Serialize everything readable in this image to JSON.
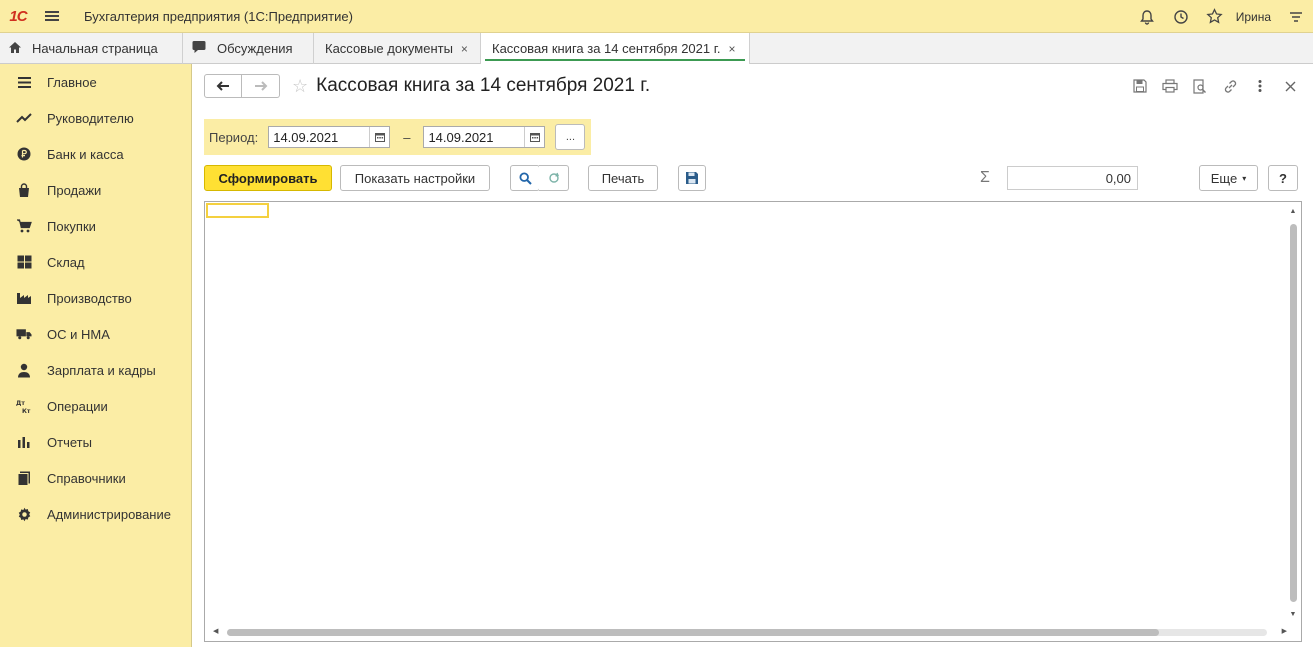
{
  "app": {
    "logo_text": "1С",
    "title": "Бухгалтерия предприятия (1С:Предприятие)",
    "user": "Ирина"
  },
  "tabs": [
    {
      "label": "Начальная страница",
      "icon": "home-icon"
    },
    {
      "label": "Обсуждения",
      "icon": "chat-icon"
    },
    {
      "label": "Кассовые документы",
      "close": "×"
    },
    {
      "label": "Кассовая книга за 14 сентября 2021 г.",
      "close": "×",
      "active": true
    }
  ],
  "sidebar": {
    "items": [
      {
        "label": "Главное",
        "icon": "menu-icon"
      },
      {
        "label": "Руководителю",
        "icon": "trend-icon"
      },
      {
        "label": "Банк и касса",
        "icon": "ruble-icon"
      },
      {
        "label": "Продажи",
        "icon": "bag-icon"
      },
      {
        "label": "Покупки",
        "icon": "cart-icon"
      },
      {
        "label": "Склад",
        "icon": "warehouse-icon"
      },
      {
        "label": "Производство",
        "icon": "factory-icon"
      },
      {
        "label": "ОС и НМА",
        "icon": "truck-icon"
      },
      {
        "label": "Зарплата и кадры",
        "icon": "person-icon"
      },
      {
        "label": "Операции",
        "icon": "dt-kt-icon"
      },
      {
        "label": "Отчеты",
        "icon": "bar-chart-icon"
      },
      {
        "label": "Справочники",
        "icon": "books-icon"
      },
      {
        "label": "Администрирование",
        "icon": "gear-icon"
      }
    ]
  },
  "form": {
    "title": "Кассовая книга за 14 сентября 2021 г.",
    "period": {
      "label": "Период:",
      "from": "14.09.2021",
      "separator": "–",
      "to": "14.09.2021",
      "dots": "..."
    },
    "toolbar": {
      "generate": "Сформировать",
      "show_settings": "Показать настройки",
      "print": "Печать",
      "sigma": "Σ",
      "sum_value": "0,00",
      "more": "Еще",
      "help": "?"
    }
  },
  "colors": {
    "accent_yellow": "#fbeda5",
    "primary_button": "#ffe033",
    "active_tab_underline": "#3c9a52",
    "logo_red": "#d0301f"
  }
}
